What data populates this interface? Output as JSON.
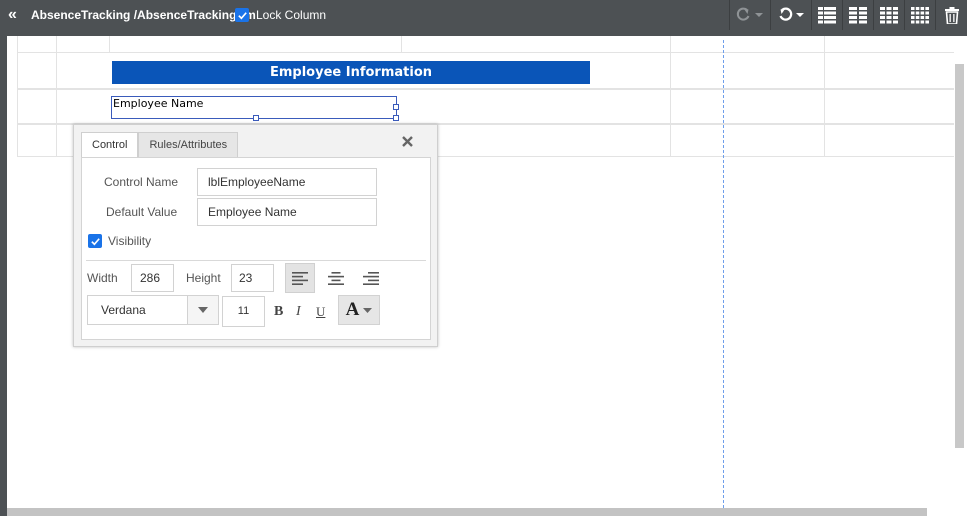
{
  "toolbar": {
    "back_icon": "double-chevron-left-icon",
    "path": "AbsenceTracking /AbsenceTrackingfrm",
    "lock_column_label": "Lock Column",
    "lock_column_checked": true
  },
  "canvas": {
    "section_header": "Employee Information",
    "selected_label_text": "Employee Name",
    "header_color": "#0a55b8"
  },
  "properties_popup": {
    "tabs": [
      "Control",
      "Rules/Attributes"
    ],
    "active_tab": "Control",
    "control_name_label": "Control Name",
    "control_name_value": "lblEmployeeName",
    "default_value_label": "Default Value",
    "default_value_value": "Employee Name",
    "visibility_label": "Visibility",
    "visibility_checked": true,
    "width_label": "Width",
    "width_value": "286",
    "height_label": "Height",
    "height_value": "23",
    "font_family": "Verdana",
    "font_size": "11",
    "bold_label": "B",
    "italic_label": "I",
    "underline_label": "U",
    "font_color_label": "A"
  },
  "colors": {
    "toolbar_bg": "#4d5154",
    "accent_blue": "#1a73e8",
    "guide_line": "#6d9eeb"
  }
}
